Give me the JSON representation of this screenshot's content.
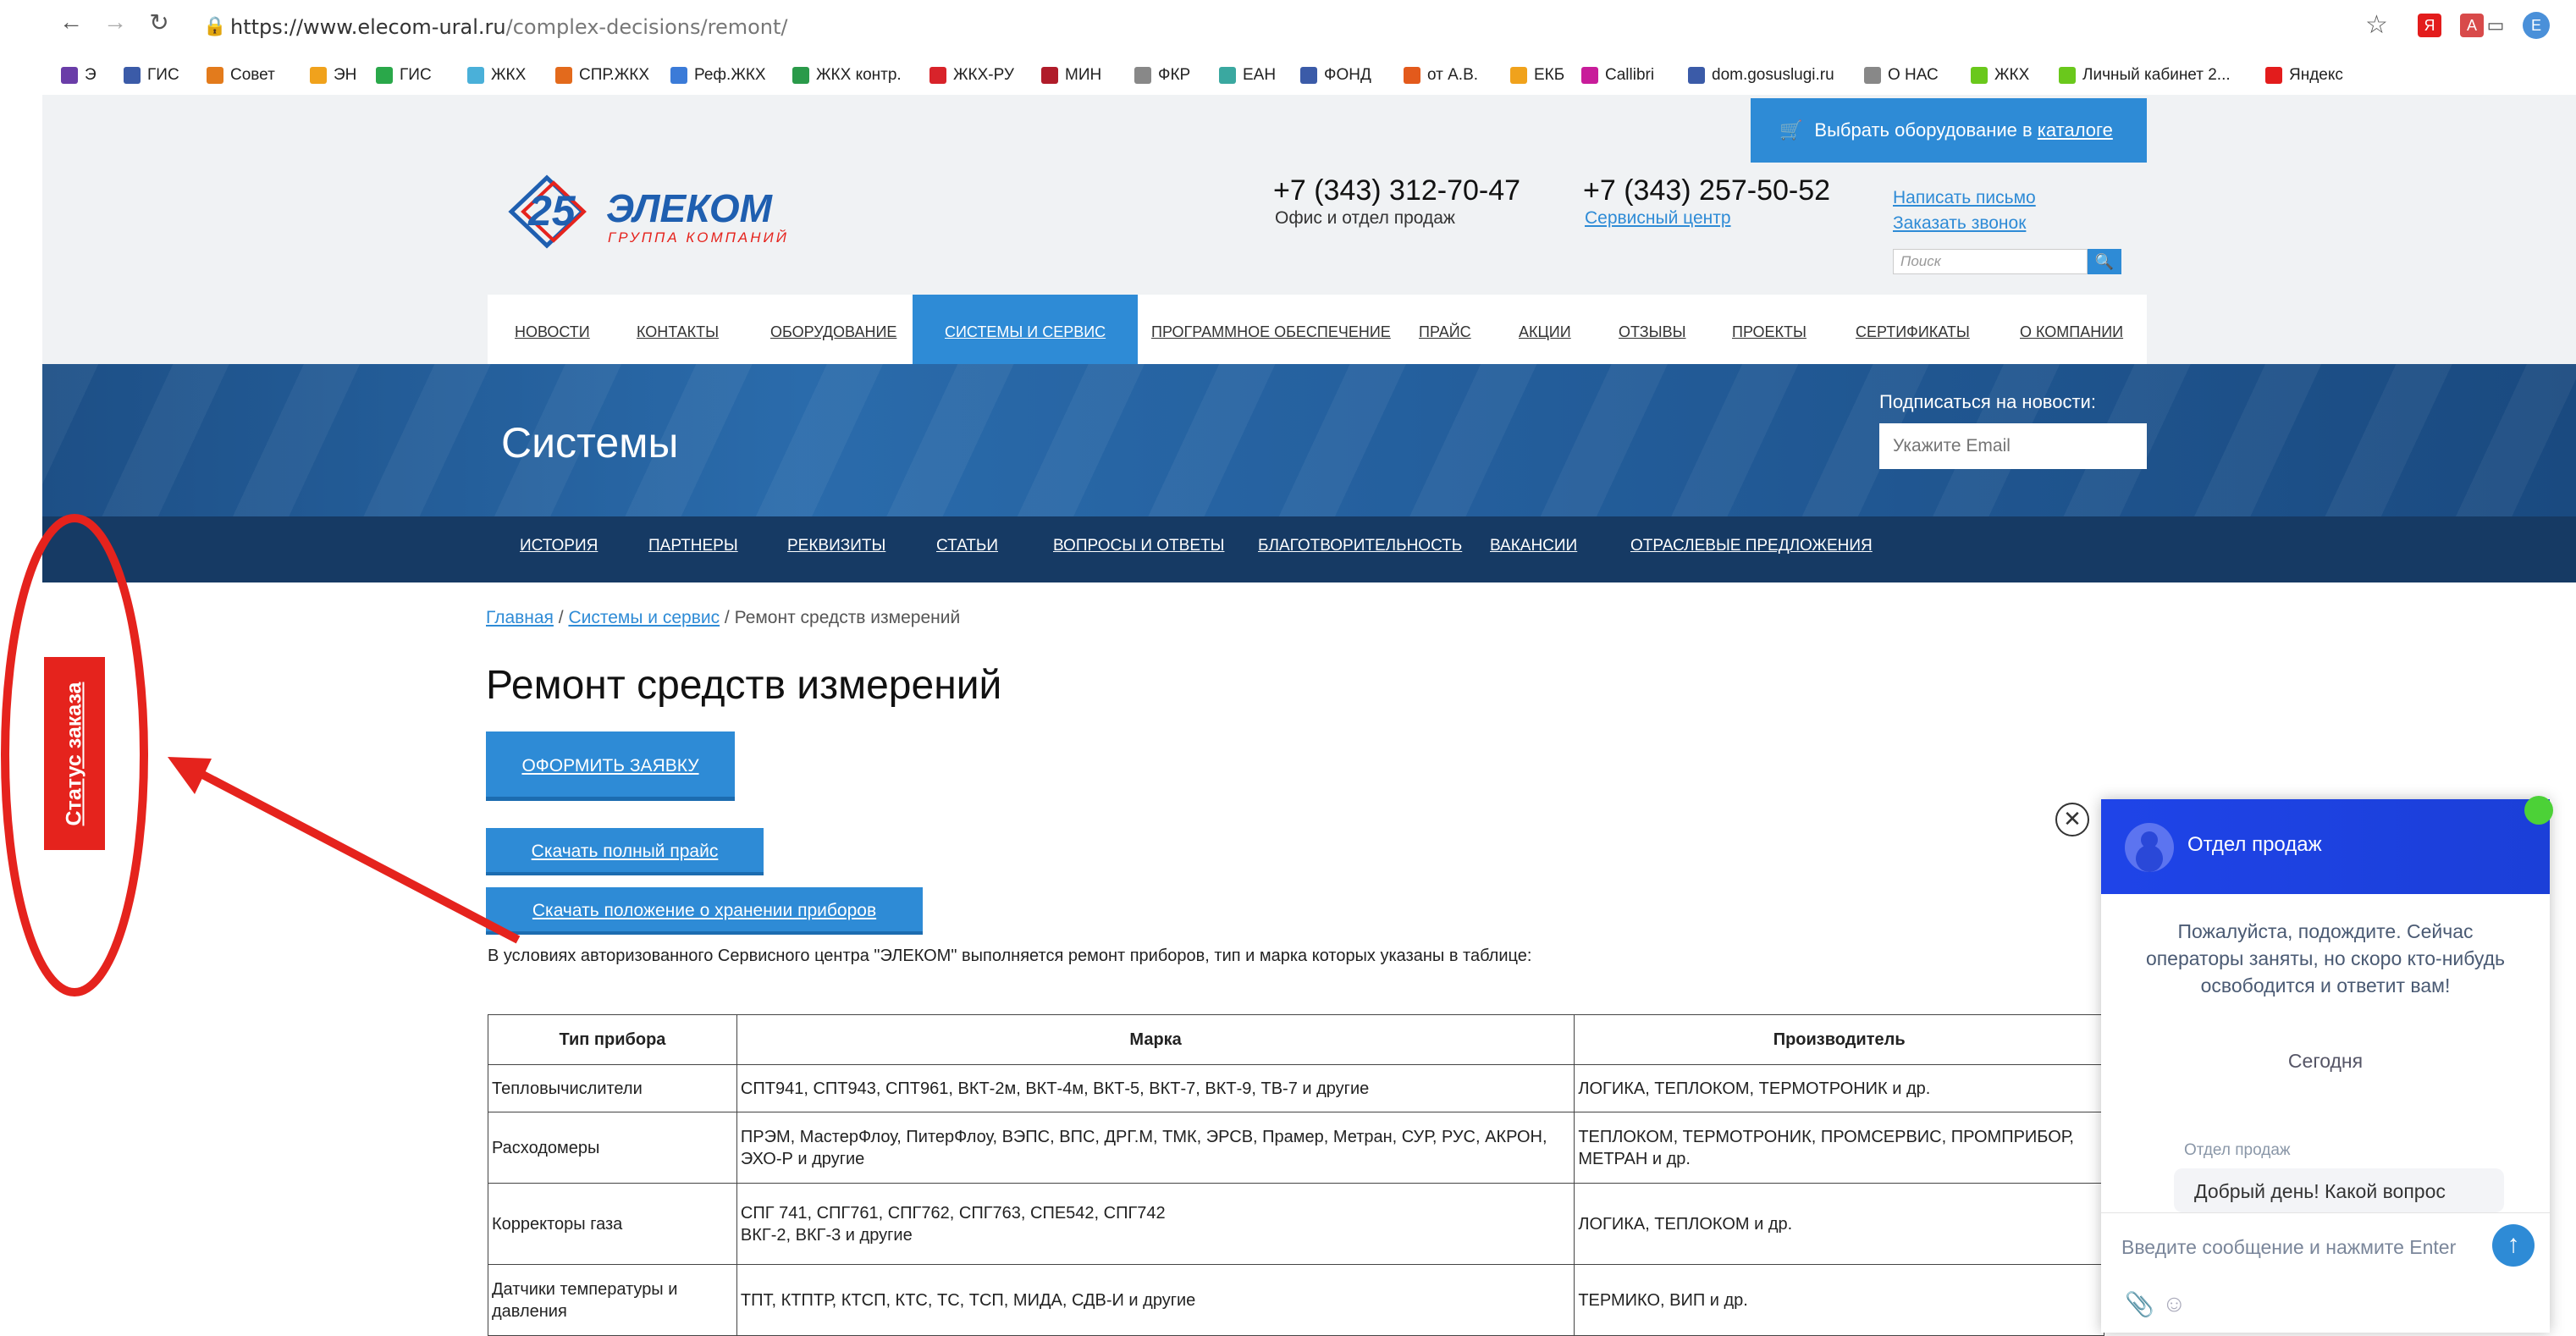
{
  "browser": {
    "url_host": "https://www.elecom-ural.ru",
    "url_path": "/complex-decisions/remont/",
    "profile_initial": "E",
    "bookmarks": [
      {
        "label": "Э",
        "color": "#6a3da8"
      },
      {
        "label": "ГИС",
        "color": "#3b5ba8"
      },
      {
        "label": "Совет",
        "color": "#e37b1c"
      },
      {
        "label": "ЭН",
        "color": "#f0a21c"
      },
      {
        "label": "ГИС",
        "color": "#2aa84a"
      },
      {
        "label": "ЖКХ",
        "color": "#4ab0d9"
      },
      {
        "label": "СПР.ЖКХ",
        "color": "#e36a1c"
      },
      {
        "label": "Реф.ЖКХ",
        "color": "#3b7bd8"
      },
      {
        "label": "ЖКХ контр.",
        "color": "#2a9a4a"
      },
      {
        "label": "ЖКХ-РУ",
        "color": "#d8232a"
      },
      {
        "label": "МИН",
        "color": "#b01c2a"
      },
      {
        "label": "ФКР",
        "color": "#888888"
      },
      {
        "label": "ЕАН",
        "color": "#3aa8a0"
      },
      {
        "label": "ФОНД",
        "color": "#3b5ba8"
      },
      {
        "label": "от А.В.",
        "color": "#e35a1c"
      },
      {
        "label": "ЕКБ",
        "color": "#f0a21c"
      },
      {
        "label": "Callibri",
        "color": "#c81c9a"
      },
      {
        "label": "dom.gosuslugi.ru",
        "color": "#3b5ba8"
      },
      {
        "label": "О НАС",
        "color": "#888888"
      },
      {
        "label": "ЖКХ",
        "color": "#6ac81c"
      },
      {
        "label": "Личный кабинет 2...",
        "color": "#6ac81c"
      },
      {
        "label": "Яндекс",
        "color": "#e31c1c"
      }
    ]
  },
  "header": {
    "catalog_prefix": "Выбрать оборудование в ",
    "catalog_link": "каталоге",
    "logo_number": "25",
    "logo_name": "ЭЛЕКОМ",
    "logo_tagline": "ГРУППА КОМПАНИЙ",
    "phone1": "+7 (343) 312-70-47",
    "phone1_sub": "Офис и отдел продаж",
    "phone2": "+7 (343) 257-50-52",
    "phone2_sub": "Сервисный центр",
    "write_letter": "Написать письмо",
    "order_call": "Заказать звонок",
    "search_placeholder": "Поиск"
  },
  "topnav": [
    "Новости",
    "Контакты",
    "Оборудование",
    "Системы и сервис",
    "Программное обеспечение",
    "Прайс",
    "Акции",
    "Отзывы",
    "Проекты",
    "Сертификаты",
    "О компании"
  ],
  "banner": {
    "title": "Системы",
    "subscribe_label": "Подписаться на новости:",
    "email_placeholder": "Укажите Email"
  },
  "subnav": [
    "История",
    "Партнеры",
    "Реквизиты",
    "Статьи",
    "Вопросы и ответы",
    "Благотворительность",
    "Вакансии",
    "Отраслевые предложения"
  ],
  "content": {
    "breadcrumb": {
      "home": "Главная",
      "section": "Системы и сервис",
      "current": "Ремонт средств измерений"
    },
    "title": "Ремонт средств измерений",
    "order_button": "ОФОРМИТЬ ЗАЯВКУ",
    "download_price": "Скачать полный прайс",
    "download_storage": "Скачать положение о хранении приборов",
    "intro": "В условиях авторизованного Сервисного центра \"ЭЛЕКОМ\" выполняется ремонт приборов, тип и марка которых указаны в таблице:",
    "table": {
      "headers": [
        "Тип прибора",
        "Марка",
        "Производитель"
      ],
      "rows": [
        [
          "Тепловычислители",
          "СПТ941, СПТ943, СПТ961, ВКТ-2м, ВКТ-4м, ВКТ-5, ВКТ-7, ВКТ-9, ТВ-7 и другие",
          "ЛОГИКА, ТЕПЛОКОМ, ТЕРМОТРОНИК и др."
        ],
        [
          "Расходомеры",
          "ПРЭМ, МастерФлоу, ПитерФлоу, ВЭПС, ВПС, ДРГ.М, ТМК, ЭРСВ, Прамер, Метран, СУР, РУС, АКРОН, ЭХО-Р и другие",
          "ТЕПЛОКОМ, ТЕРМОТРОНИК, ПРОМСЕРВИС, ПРОМПРИБОР, МЕТРАН и др."
        ],
        [
          "Корректоры газа",
          "СПГ 741, СПГ761, СПГ762, СПГ763, СПЕ542, СПГ742\nВКГ-2, ВКГ-3 и другие",
          "ЛОГИКА, ТЕПЛОКОМ и др."
        ],
        [
          "Датчики температуры и давления",
          "ТПТ, КТПТР, КТСП, КТС, ТС, ТСП, МИДА, СДВ-И и другие",
          "ТЕРМИКО, ВИП и др."
        ]
      ]
    }
  },
  "status_tab": "Статус заказа",
  "annotation_color": "#e5231d",
  "chat": {
    "title": "Отдел продаж",
    "waiting": "Пожалуйста, подождите. Сейчас операторы заняты, но скоро кто-нибудь освободится и ответит вам!",
    "today": "Сегодня",
    "agent": "Отдел продаж",
    "message": "Добрый день! Какой вопрос",
    "input_placeholder": "Введите сообщение и нажмите Enter"
  }
}
